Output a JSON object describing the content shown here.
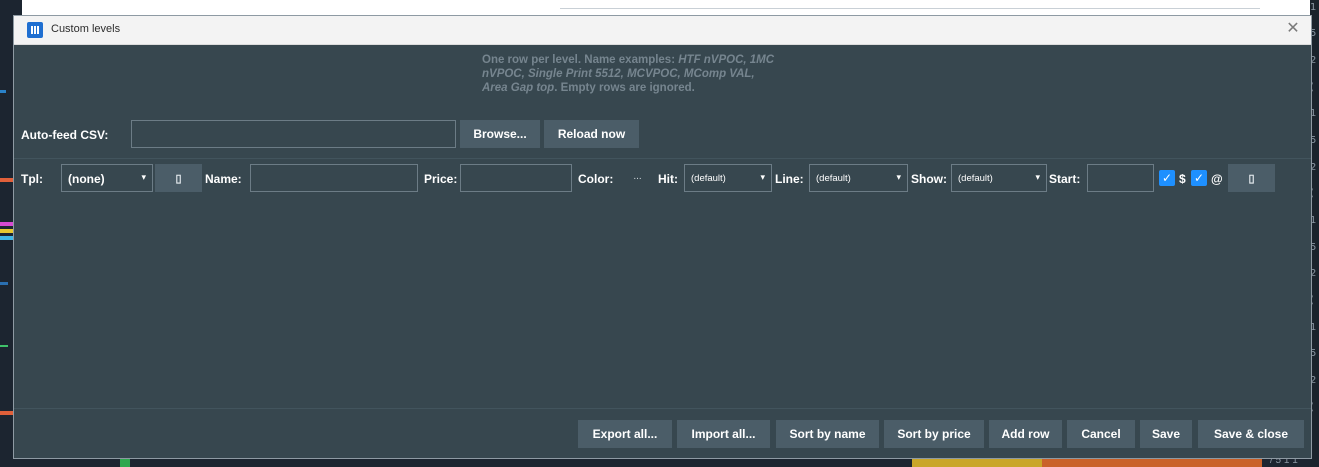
{
  "window": {
    "title": "Custom levels",
    "close_symbol": "✕"
  },
  "help": {
    "lead": "One row per level. Name examples: ",
    "examples": "HTF nVPOC, 1MC nVPOC, Single Print 5512, MCVPOC, MComp VAL, Area Gap top",
    "tail": ". Empty rows are ignored."
  },
  "autofeed": {
    "label": "Auto-feed CSV:",
    "value": "",
    "browse_label": "Browse...",
    "reload_label": "Reload now"
  },
  "row": {
    "tpl_label": "Tpl:",
    "tpl_value": "(none)",
    "tpl_action_glyph": "▯",
    "name_label": "Name:",
    "name_value": "",
    "price_label": "Price:",
    "price_value": "",
    "color_label": "Color:",
    "color_value_text": "...",
    "hit_label": "Hit:",
    "hit_value": "(default)",
    "line_label": "Line:",
    "line_value": "(default)",
    "show_label": "Show:",
    "show_value": "(default)",
    "start_label": "Start:",
    "start_value": "",
    "dollar_checked": true,
    "dollar_label": "$",
    "at_checked": true,
    "at_label": "@",
    "delete_glyph": "▯",
    "dropdown_arrow": "▾"
  },
  "footer": {
    "export_all": "Export all...",
    "import_all": "Import all...",
    "sort_by_name": "Sort by name",
    "sort_by_price": "Sort by price",
    "add_row": "Add row",
    "cancel": "Cancel",
    "save": "Save",
    "save_close": "Save & close"
  },
  "colors": {
    "dialog_bg": "#37474f",
    "button_bg": "#4b5d68",
    "checkbox": "#1e90ff",
    "help_text": "#76858f"
  },
  "background": {
    "right_axis_glimpse": [
      "1",
      "5",
      "2",
      "(",
      "1",
      "5",
      "2",
      "(",
      "1",
      "5",
      "2",
      "(",
      "1",
      "5",
      "2",
      "("
    ],
    "bottom_right_text": "/ 5 1 1"
  }
}
